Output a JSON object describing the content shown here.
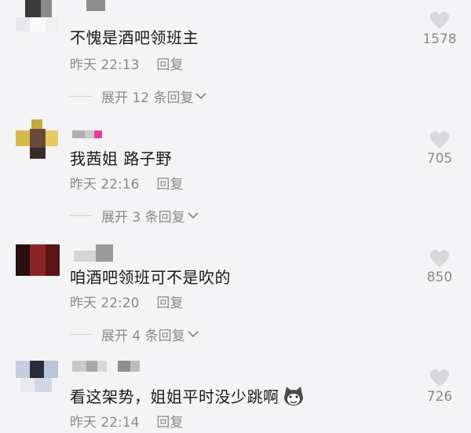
{
  "comments": [
    {
      "text": "不愧是酒吧领班主",
      "time": "昨天 22:13",
      "reply": "回复",
      "expand": "展开 12 条回复",
      "likes": "1578",
      "icons": {
        "like": "heart-icon",
        "expand": "chevron-down-icon"
      }
    },
    {
      "text": "我茜姐 路子野",
      "time": "昨天 22:16",
      "reply": "回复",
      "expand": "展开 3 条回复",
      "likes": "705",
      "icons": {
        "like": "heart-icon",
        "expand": "chevron-down-icon"
      }
    },
    {
      "text": "咱酒吧领班可不是吹的",
      "time": "昨天 22:20",
      "reply": "回复",
      "expand": "展开 4 条回复",
      "likes": "850",
      "icons": {
        "like": "heart-icon",
        "expand": "chevron-down-icon"
      }
    },
    {
      "text": "看这架势，姐姐平时没少跳啊",
      "time": "昨天 22:14",
      "reply": "回复",
      "likes": "726",
      "icons": {
        "like": "heart-icon",
        "emoji": "husky-dog-emoji"
      }
    }
  ],
  "colors": {
    "background": "#f4f4f6",
    "secondary_text": "#8a8a8a",
    "heart": "#d9d9dc"
  }
}
